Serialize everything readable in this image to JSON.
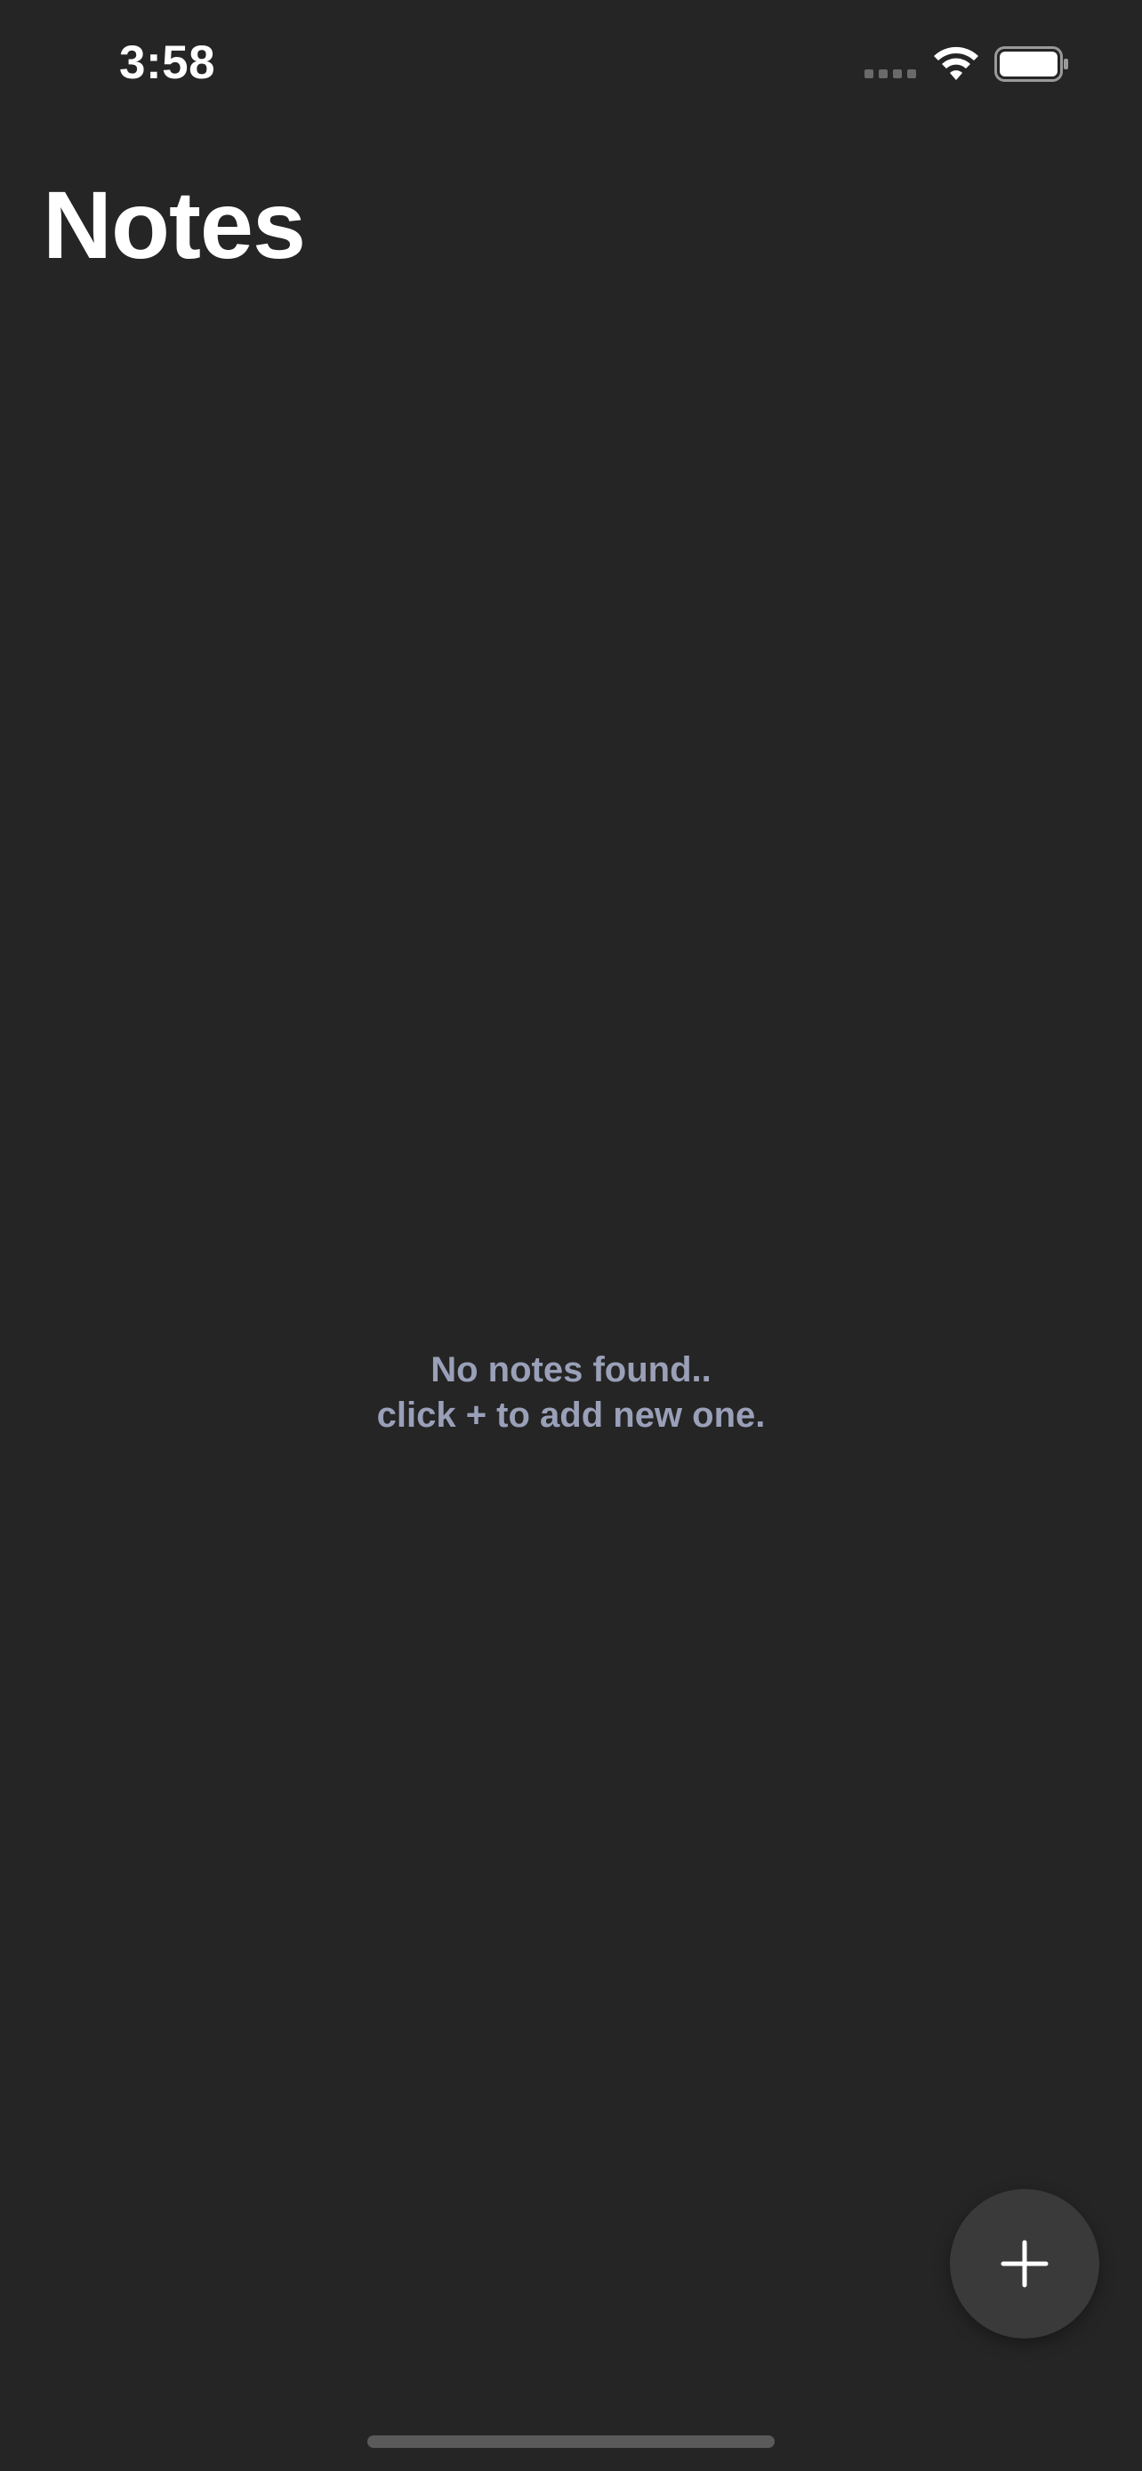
{
  "status_bar": {
    "time": "3:58",
    "icons": [
      "signal-icon",
      "wifi-icon",
      "battery-icon"
    ]
  },
  "header": {
    "title": "Notes"
  },
  "empty_state": {
    "line1": "No notes found..",
    "line2": "click + to add new one."
  },
  "fab": {
    "icon": "plus-icon",
    "label": "+"
  },
  "colors": {
    "background": "#252525",
    "title": "#ffffff",
    "empty_text": "#9aa0b8",
    "fab_bg": "#3a3a3a"
  }
}
